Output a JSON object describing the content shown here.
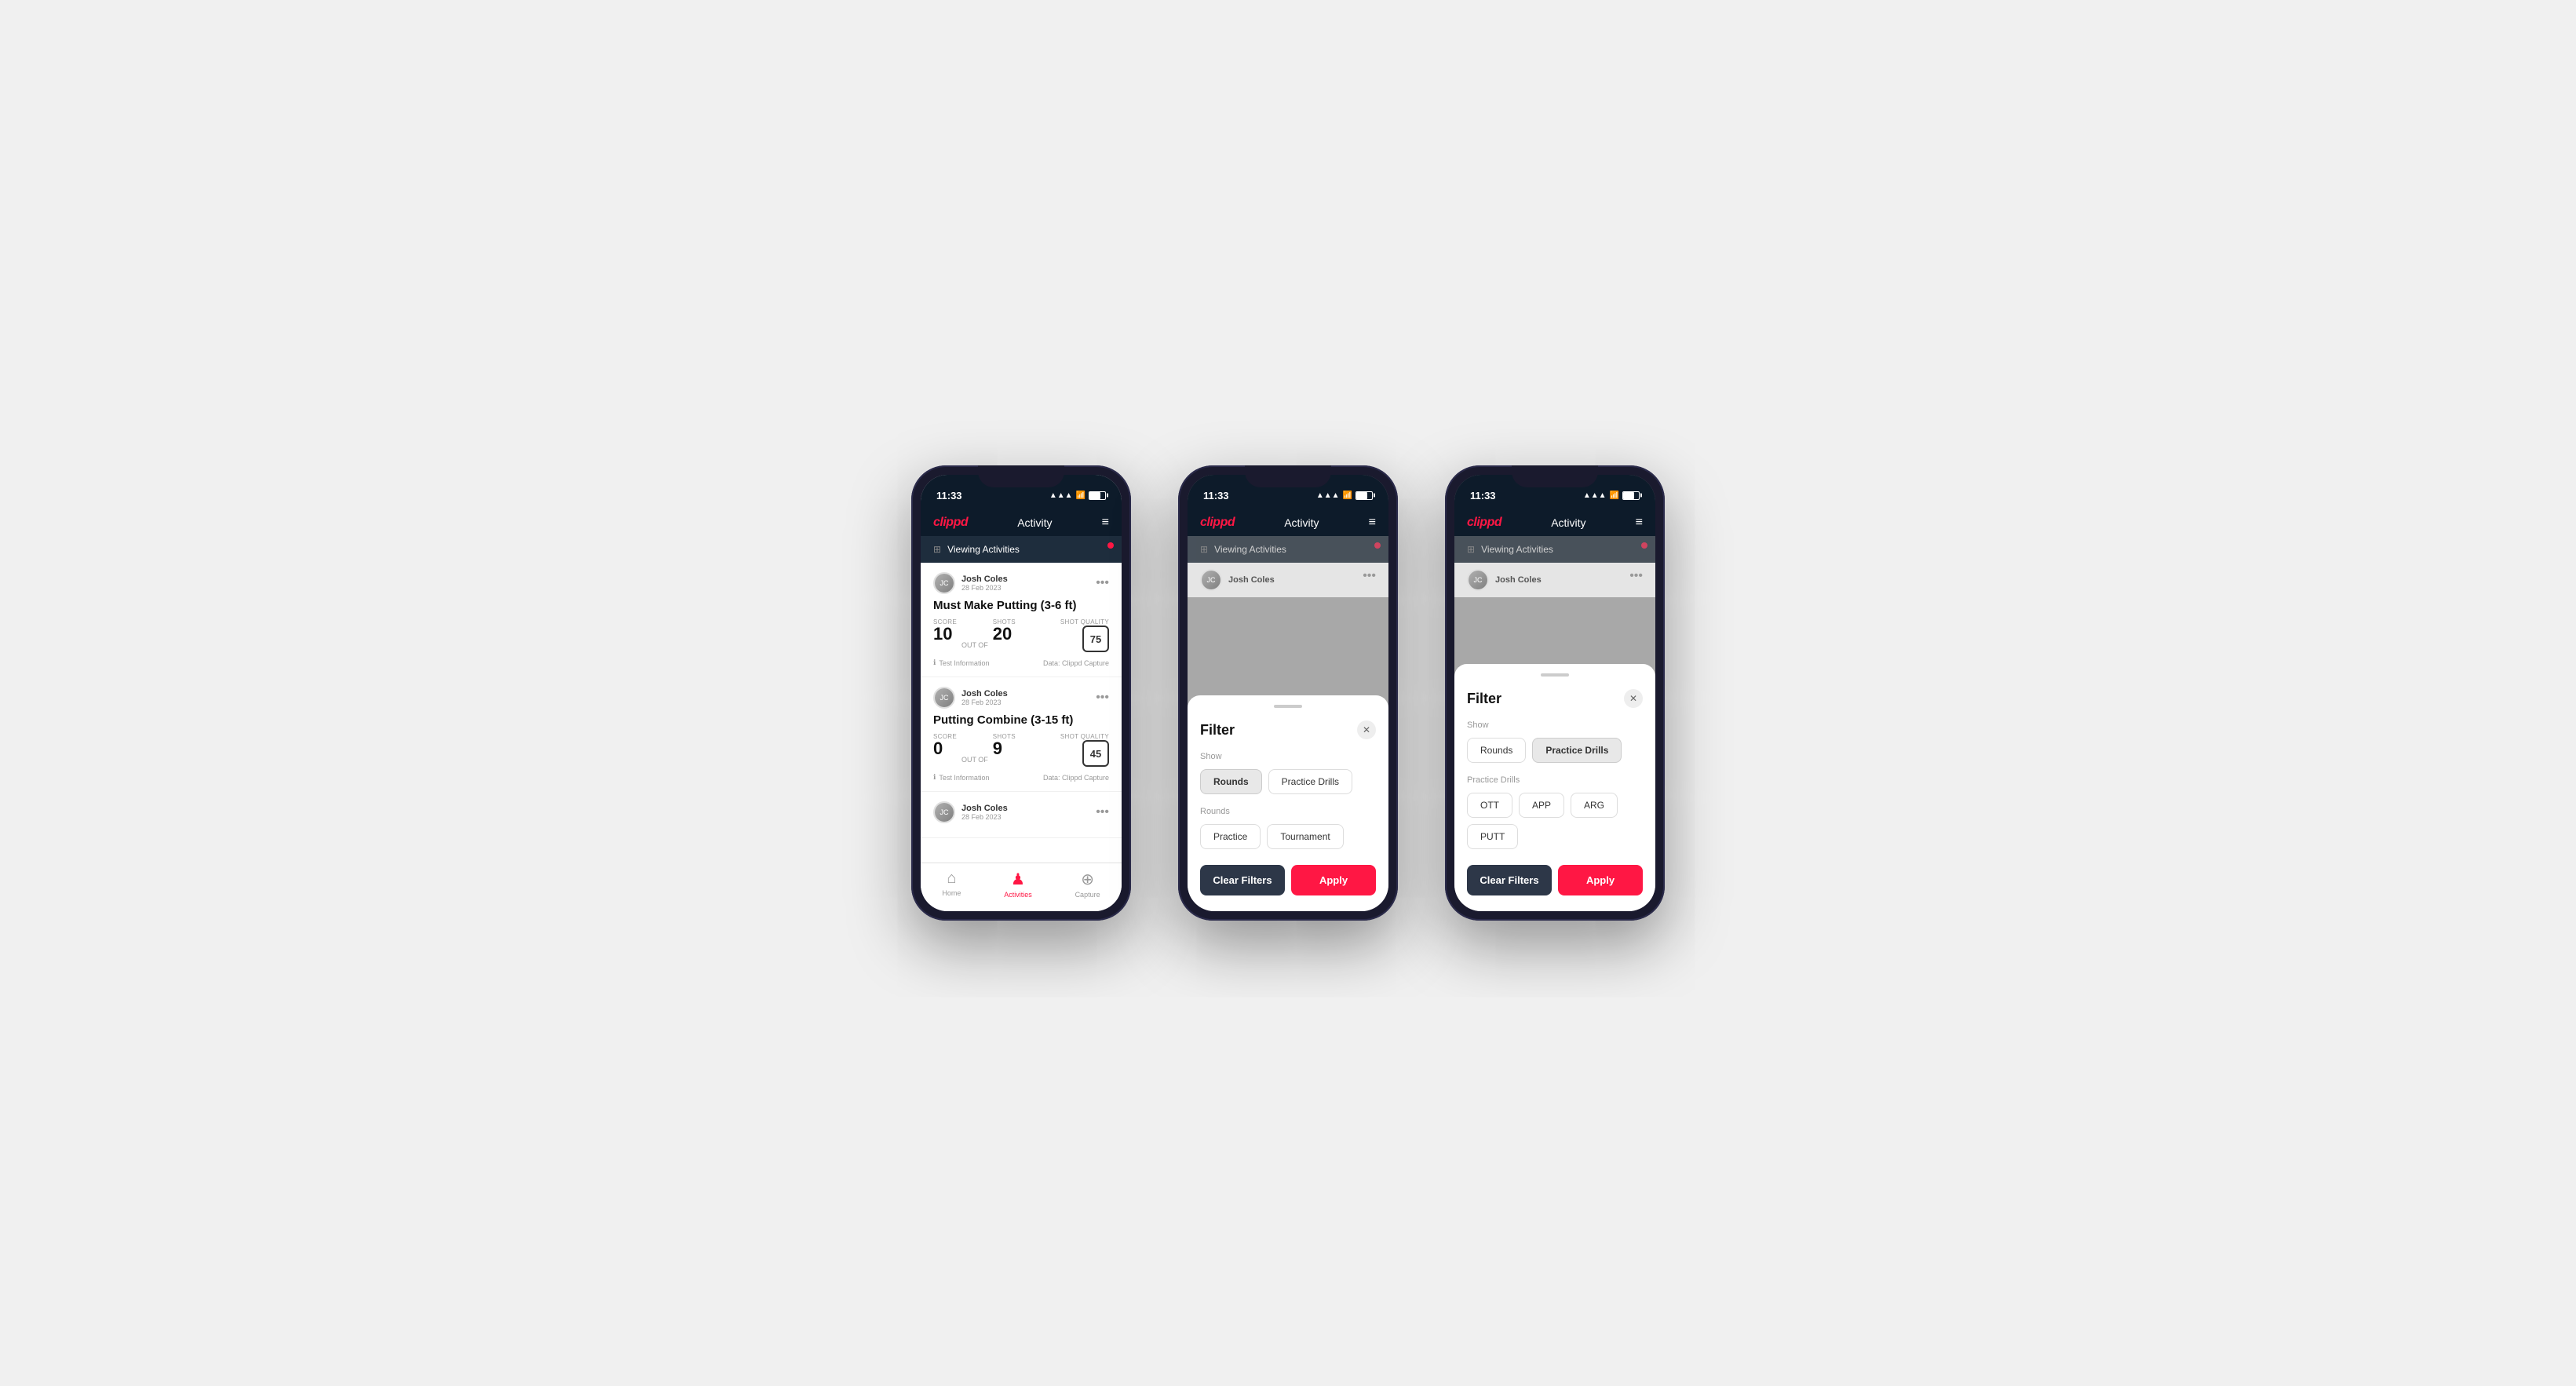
{
  "phones": [
    {
      "id": "phone1",
      "statusBar": {
        "time": "11:33",
        "signal": "▲▲▲",
        "wifi": "WiFi",
        "battery": "31"
      },
      "header": {
        "logo": "clippd",
        "title": "Activity",
        "menuIcon": "≡"
      },
      "viewingBar": {
        "text": "Viewing Activities",
        "filterIconLabel": "filter-icon"
      },
      "activities": [
        {
          "userName": "Josh Coles",
          "userDate": "28 Feb 2023",
          "title": "Must Make Putting (3-6 ft)",
          "score": "10",
          "outOf": "OUT OF",
          "shots": "20",
          "shotQualityLabel": "Shot Quality",
          "shotQuality": "75",
          "footer": {
            "info": "Test Information",
            "data": "Data: Clippd Capture"
          }
        },
        {
          "userName": "Josh Coles",
          "userDate": "28 Feb 2023",
          "title": "Putting Combine (3-15 ft)",
          "score": "0",
          "outOf": "OUT OF",
          "shots": "9",
          "shotQualityLabel": "Shot Quality",
          "shotQuality": "45",
          "footer": {
            "info": "Test Information",
            "data": "Data: Clippd Capture"
          }
        },
        {
          "userName": "Josh Coles",
          "userDate": "28 Feb 2023",
          "title": "",
          "score": "",
          "outOf": "",
          "shots": "",
          "shotQualityLabel": "",
          "shotQuality": "",
          "footer": {
            "info": "",
            "data": ""
          }
        }
      ],
      "bottomNav": [
        {
          "label": "Home",
          "icon": "⌂",
          "active": false
        },
        {
          "label": "Activities",
          "icon": "♟",
          "active": true
        },
        {
          "label": "Capture",
          "icon": "⊕",
          "active": false
        }
      ]
    },
    {
      "id": "phone2",
      "statusBar": {
        "time": "11:33",
        "signal": "▲▲▲",
        "wifi": "WiFi",
        "battery": "31"
      },
      "header": {
        "logo": "clippd",
        "title": "Activity",
        "menuIcon": "≡"
      },
      "viewingBar": {
        "text": "Viewing Activities"
      },
      "filter": {
        "title": "Filter",
        "showLabel": "Show",
        "showButtons": [
          {
            "label": "Rounds",
            "active": true
          },
          {
            "label": "Practice Drills",
            "active": false
          }
        ],
        "roundsLabel": "Rounds",
        "roundsButtons": [
          {
            "label": "Practice",
            "active": false
          },
          {
            "label": "Tournament",
            "active": false
          }
        ],
        "clearLabel": "Clear Filters",
        "applyLabel": "Apply"
      }
    },
    {
      "id": "phone3",
      "statusBar": {
        "time": "11:33",
        "signal": "▲▲▲",
        "wifi": "WiFi",
        "battery": "31"
      },
      "header": {
        "logo": "clippd",
        "title": "Activity",
        "menuIcon": "≡"
      },
      "viewingBar": {
        "text": "Viewing Activities"
      },
      "filter": {
        "title": "Filter",
        "showLabel": "Show",
        "showButtons": [
          {
            "label": "Rounds",
            "active": false
          },
          {
            "label": "Practice Drills",
            "active": true
          }
        ],
        "drillsLabel": "Practice Drills",
        "drillsButtons": [
          {
            "label": "OTT",
            "active": false
          },
          {
            "label": "APP",
            "active": false
          },
          {
            "label": "ARG",
            "active": false
          },
          {
            "label": "PUTT",
            "active": false
          }
        ],
        "clearLabel": "Clear Filters",
        "applyLabel": "Apply"
      }
    }
  ]
}
